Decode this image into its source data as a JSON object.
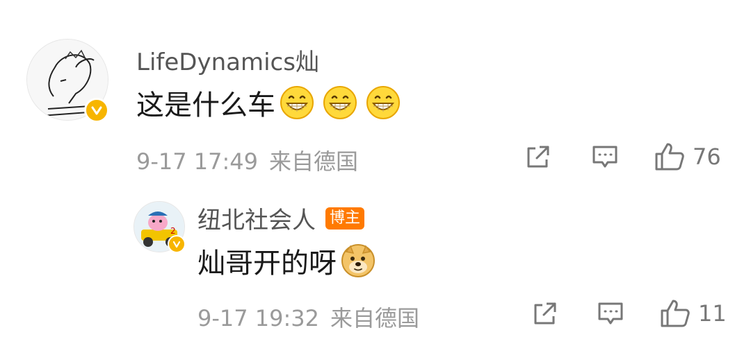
{
  "comments": [
    {
      "username": "LifeDynamics灿",
      "text": "这是什么车",
      "emojis": [
        "grin-icon",
        "grin-icon",
        "grin-icon"
      ],
      "time": "9-17 17:49",
      "source": "来自德国",
      "likes": "76",
      "verified": true
    },
    {
      "username": "纽北社会人",
      "badge": "博主",
      "text": "灿哥开的呀",
      "emojis": [
        "doge-icon"
      ],
      "time": "9-17 19:32",
      "source": "来自德国",
      "likes": "11",
      "verified": true
    }
  ],
  "colors": {
    "verified_badge": "#f7b500",
    "blogger_badge": "#ff7a00",
    "meta_text": "#9a9a9a"
  }
}
